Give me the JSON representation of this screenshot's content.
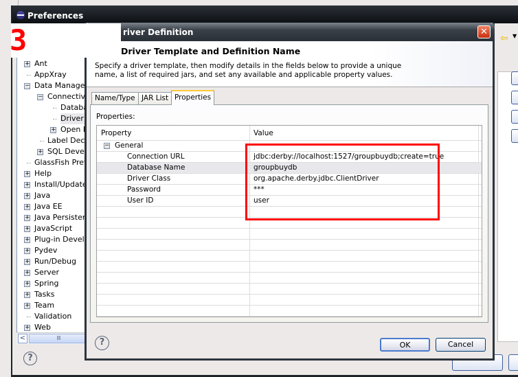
{
  "annotation": "3",
  "prefs": {
    "title": "Preferences",
    "tree": [
      {
        "label": "Ant",
        "level": 0,
        "expander": "+"
      },
      {
        "label": "AppXray",
        "level": 0,
        "expander": ""
      },
      {
        "label": "Data Managem",
        "level": 0,
        "expander": "-"
      },
      {
        "label": "Connectivit",
        "level": 1,
        "expander": "-"
      },
      {
        "label": "Databa",
        "level": 2,
        "expander": ""
      },
      {
        "label": "Driver I",
        "level": 2,
        "expander": "",
        "selected": true
      },
      {
        "label": "Open D",
        "level": 2,
        "expander": "+"
      },
      {
        "label": "Label Deco",
        "level": 1,
        "expander": ""
      },
      {
        "label": "SQL Develo",
        "level": 1,
        "expander": "+"
      },
      {
        "label": "GlassFish Prefe",
        "level": 0,
        "expander": ""
      },
      {
        "label": "Help",
        "level": 0,
        "expander": "+"
      },
      {
        "label": "Install/Update",
        "level": 0,
        "expander": "+"
      },
      {
        "label": "Java",
        "level": 0,
        "expander": "+"
      },
      {
        "label": "Java EE",
        "level": 0,
        "expander": "+"
      },
      {
        "label": "Java Persistenc",
        "level": 0,
        "expander": "+"
      },
      {
        "label": "JavaScript",
        "level": 0,
        "expander": "+"
      },
      {
        "label": "Plug-in Develop",
        "level": 0,
        "expander": "+"
      },
      {
        "label": "Pydev",
        "level": 0,
        "expander": "+"
      },
      {
        "label": "Run/Debug",
        "level": 0,
        "expander": "+"
      },
      {
        "label": "Server",
        "level": 0,
        "expander": "+"
      },
      {
        "label": "Spring",
        "level": 0,
        "expander": "+"
      },
      {
        "label": "Tasks",
        "level": 0,
        "expander": "+"
      },
      {
        "label": "Team",
        "level": 0,
        "expander": "+"
      },
      {
        "label": "Validation",
        "level": 0,
        "expander": ""
      },
      {
        "label": "Web",
        "level": 0,
        "expander": "+"
      }
    ],
    "help_icon": "?",
    "back_icon": "⇦",
    "scroll_left": "<",
    "scroll_grip": "IIII"
  },
  "dialog": {
    "title": "river Definition",
    "heading": "Driver Template and Definition Name",
    "description": "Specify a driver template, then modify details in the fields below to provide a unique name, a list of required jars, and set any available and applicable property values.",
    "close_icon": "✕",
    "tabs": [
      {
        "label": "Name/Type",
        "active": false
      },
      {
        "label": "JAR List",
        "active": false
      },
      {
        "label": "Properties",
        "active": true
      }
    ],
    "properties_label": "Properties:",
    "table": {
      "headers": [
        "Property",
        "Value"
      ],
      "group": {
        "label": "General",
        "expander": "-"
      },
      "rows": [
        {
          "property": "Connection URL",
          "value": "jdbc:derby://localhost:1527/groupbuydb;create=true"
        },
        {
          "property": "Database Name",
          "value": "groupbuydb",
          "selected": true
        },
        {
          "property": "Driver Class",
          "value": "org.apache.derby.jdbc.ClientDriver"
        },
        {
          "property": "Password",
          "value": "***"
        },
        {
          "property": "User ID",
          "value": "user"
        }
      ]
    },
    "help_icon": "?",
    "ok_label": "OK",
    "cancel_label": "Cancel"
  },
  "colors": {
    "highlight": "#ff0000",
    "tab_accent": "#ffc83c"
  }
}
